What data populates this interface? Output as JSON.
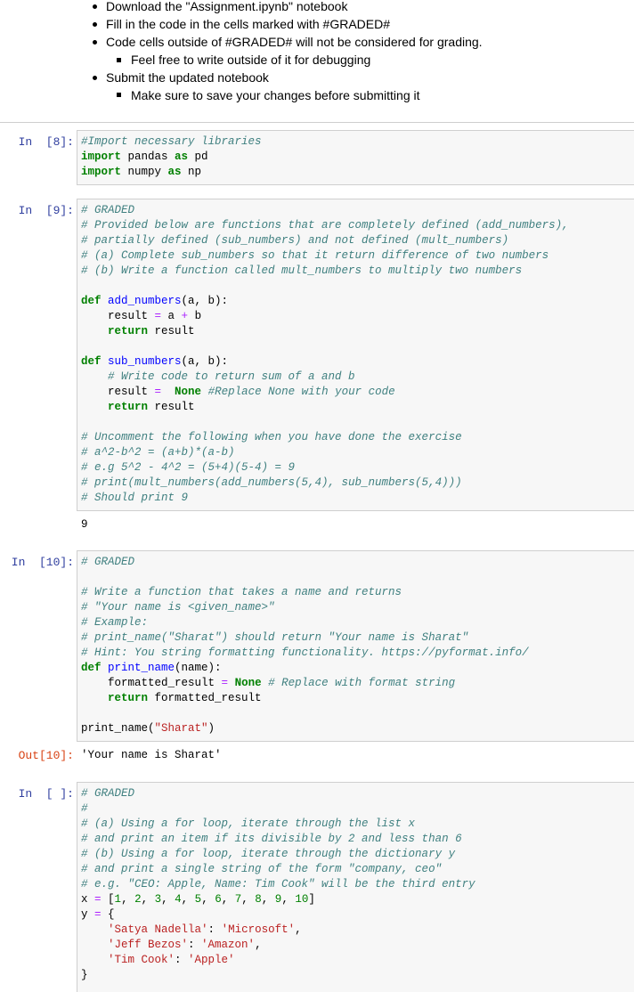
{
  "instructions": {
    "items": [
      {
        "text": "Download the \"Assignment.ipynb\" notebook",
        "level": 1
      },
      {
        "text": "Fill in the code in the cells marked with #GRADED#",
        "level": 1
      },
      {
        "text": "Code cells outside of #GRADED# will not be considered for grading.",
        "level": 1
      },
      {
        "text": "Feel free to write outside of it for debugging",
        "level": 2
      },
      {
        "text": "Submit the updated notebook",
        "level": 1
      },
      {
        "text": "Make sure to save your changes before submitting it",
        "level": 2
      }
    ]
  },
  "cells": [
    {
      "prompt": "In  [8]:",
      "type": "code"
    },
    {
      "prompt": "In  [9]:",
      "type": "code",
      "output": "9"
    },
    {
      "prompt": "In  [10]:",
      "type": "code",
      "output_prompt": "Out[10]:",
      "output": "'Your name is Sharat'"
    },
    {
      "prompt": "In  [ ]:",
      "type": "code"
    }
  ],
  "colors": {
    "in_prompt": "#303f9f",
    "out_prompt": "#d84315",
    "cell_bg": "#f7f7f7",
    "comment": "#408080",
    "keyword": "#008000",
    "operator": "#aa22ff",
    "function": "#0000ff",
    "string": "#ba2121"
  }
}
